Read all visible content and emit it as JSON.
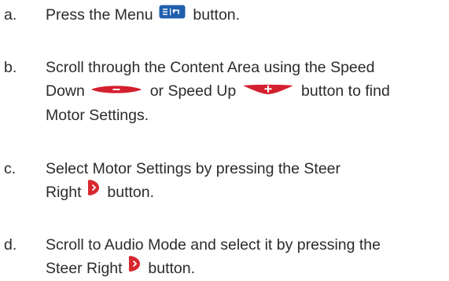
{
  "instructions": {
    "a": {
      "letter": "a.",
      "l1_before": "Press the Menu",
      "l1_after": "button.",
      "menu_icon": "menu-button-icon"
    },
    "b": {
      "letter": "b.",
      "l1": "Scroll through the Content Area using the Speed",
      "l2_before": "Down",
      "l2_mid": "or Speed Up",
      "l2_after": "button to find",
      "l3": "Motor Settings.",
      "speed_down_icon": "speed-down-button-icon",
      "speed_up_icon": "speed-up-button-icon"
    },
    "c": {
      "letter": "c.",
      "l1": "Select Motor Settings by pressing the Steer",
      "l2_before": "Right",
      "l2_after": "button.",
      "steer_right_icon": "steer-right-button-icon"
    },
    "d": {
      "letter": "d.",
      "l1": "Scroll to Audio Mode and select it by pressing the",
      "l2_before": "Steer Right",
      "l2_after": "button.",
      "steer_right_icon": "steer-right-button-icon"
    }
  },
  "colors": {
    "text": "#2b2b2b",
    "menu_blue": "#1f5fae",
    "speed_red": "#d41f2f",
    "steer_red": "#d8282f"
  }
}
